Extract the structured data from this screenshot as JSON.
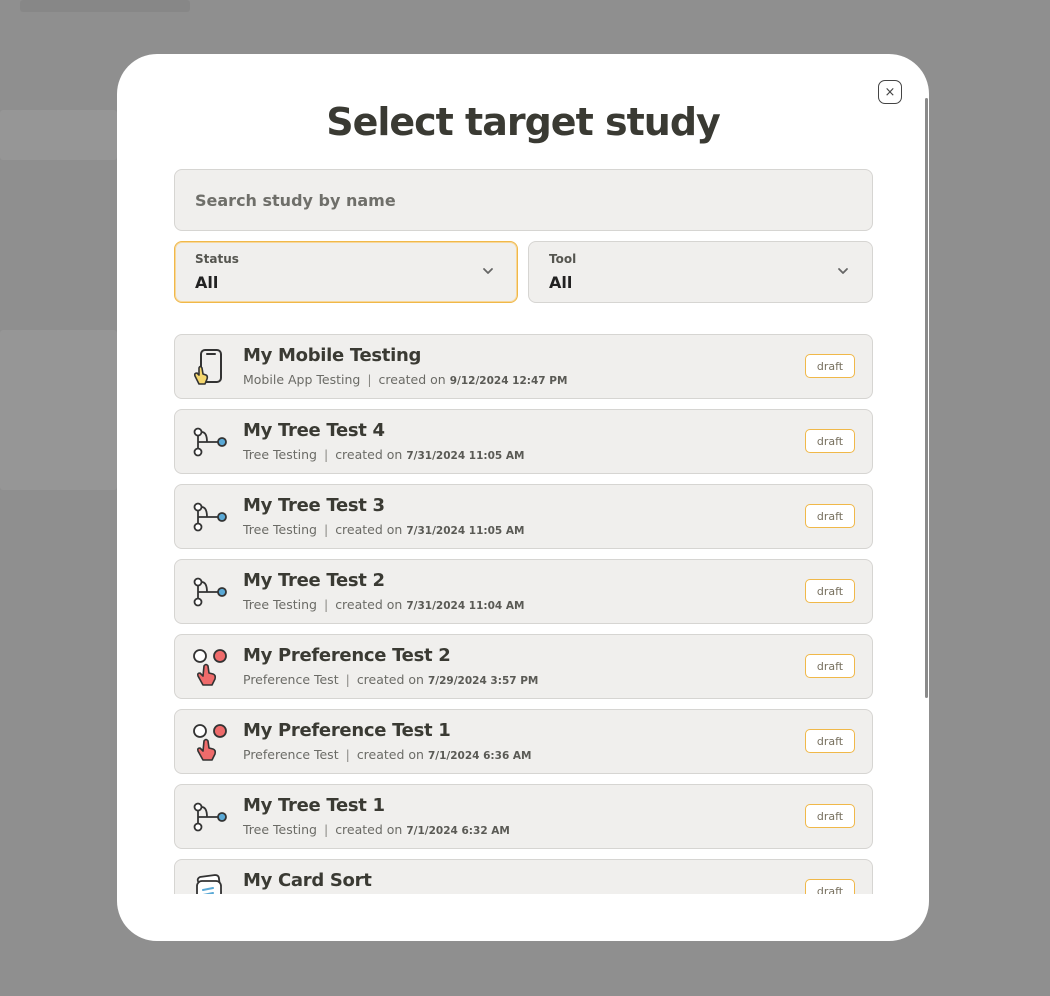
{
  "modal": {
    "title": "Select target study",
    "close_symbol": "×"
  },
  "search": {
    "placeholder": "Search study by name",
    "value": ""
  },
  "filters": {
    "status": {
      "label": "Status",
      "value": "All"
    },
    "tool": {
      "label": "Tool",
      "value": "All"
    }
  },
  "studies": [
    {
      "name": "My Mobile Testing",
      "tool": "Mobile App Testing",
      "created_prefix": "created on",
      "created": "9/12/2024 12:47 PM",
      "status": "draft",
      "icon": "mobile-testing-icon"
    },
    {
      "name": "My Tree Test 4",
      "tool": "Tree Testing",
      "created_prefix": "created on",
      "created": "7/31/2024 11:05 AM",
      "status": "draft",
      "icon": "tree-testing-icon"
    },
    {
      "name": "My Tree Test 3",
      "tool": "Tree Testing",
      "created_prefix": "created on",
      "created": "7/31/2024 11:05 AM",
      "status": "draft",
      "icon": "tree-testing-icon"
    },
    {
      "name": "My Tree Test 2",
      "tool": "Tree Testing",
      "created_prefix": "created on",
      "created": "7/31/2024 11:04 AM",
      "status": "draft",
      "icon": "tree-testing-icon"
    },
    {
      "name": "My Preference Test 2",
      "tool": "Preference Test",
      "created_prefix": "created on",
      "created": "7/29/2024 3:57 PM",
      "status": "draft",
      "icon": "preference-test-icon"
    },
    {
      "name": "My Preference Test 1",
      "tool": "Preference Test",
      "created_prefix": "created on",
      "created": "7/1/2024 6:36 AM",
      "status": "draft",
      "icon": "preference-test-icon"
    },
    {
      "name": "My Tree Test 1",
      "tool": "Tree Testing",
      "created_prefix": "created on",
      "created": "7/1/2024 6:32 AM",
      "status": "draft",
      "icon": "tree-testing-icon"
    },
    {
      "name": "My Card Sort",
      "tool": "",
      "created_prefix": "",
      "created": "",
      "status": "draft",
      "icon": "card-sort-icon"
    }
  ],
  "colors": {
    "accent": "#f0b849",
    "tree_node": "#5aa9d6",
    "preference_red": "#ef6b6b",
    "mobile_hand": "#f5d76e"
  }
}
